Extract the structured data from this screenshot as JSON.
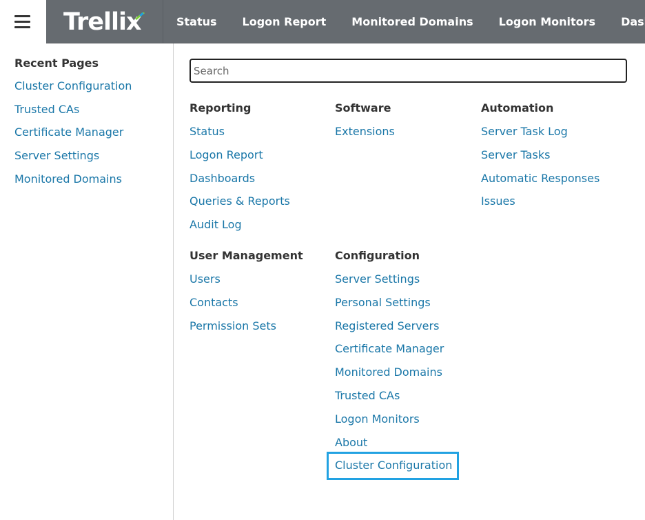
{
  "header": {
    "menu_icon": "hamburger-menu-icon",
    "logo_text": "Trellix",
    "logo_colors": [
      "#7fd13b",
      "#1ea0e0"
    ],
    "nav": [
      "Status",
      "Logon Report",
      "Monitored Domains",
      "Logon Monitors",
      "Dashboards"
    ]
  },
  "sidebar": {
    "heading": "Recent Pages",
    "items": [
      "Cluster Configuration",
      "Trusted CAs",
      "Certificate Manager",
      "Server Settings",
      "Monitored Domains"
    ]
  },
  "search": {
    "placeholder": "Search",
    "value": ""
  },
  "menu": {
    "reporting": {
      "title": "Reporting",
      "items": [
        "Status",
        "Logon Report",
        "Dashboards",
        "Queries & Reports",
        "Audit Log"
      ]
    },
    "software": {
      "title": "Software",
      "items": [
        "Extensions"
      ]
    },
    "automation": {
      "title": "Automation",
      "items": [
        "Server Task Log",
        "Server Tasks",
        "Automatic Responses",
        "Issues"
      ]
    },
    "user_management": {
      "title": "User Management",
      "items": [
        "Users",
        "Contacts",
        "Permission Sets"
      ]
    },
    "configuration": {
      "title": "Configuration",
      "items": [
        "Server Settings",
        "Personal Settings",
        "Registered Servers",
        "Certificate Manager",
        "Monitored Domains",
        "Trusted CAs",
        "Logon Monitors",
        "About",
        "Cluster Configuration"
      ]
    }
  },
  "colors": {
    "link": "#1a77a8",
    "header_bg": "#666b70",
    "focus": "#22a2e2"
  }
}
